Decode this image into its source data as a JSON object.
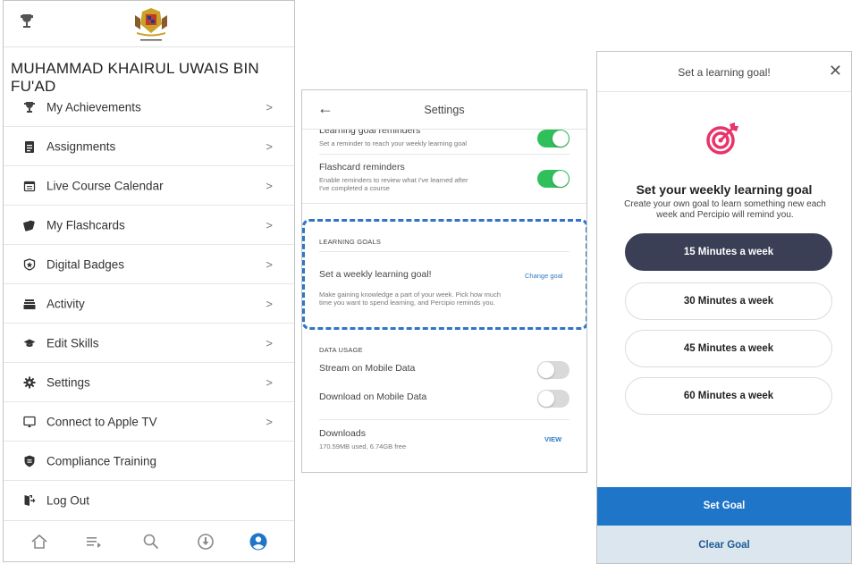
{
  "profile": {
    "user_name": "MUHAMMAD KHAIRUL UWAIS BIN FU'AD",
    "menu": [
      {
        "label": "My Achievements",
        "icon": "trophy-icon",
        "chevron": ">"
      },
      {
        "label": "Assignments",
        "icon": "clipboard-icon",
        "chevron": ">"
      },
      {
        "label": "Live Course Calendar",
        "icon": "calendar-icon",
        "chevron": ">"
      },
      {
        "label": "My Flashcards",
        "icon": "flashcards-icon",
        "chevron": ">"
      },
      {
        "label": "Digital Badges",
        "icon": "badge-icon",
        "chevron": ">"
      },
      {
        "label": "Activity",
        "icon": "activity-icon",
        "chevron": ">"
      },
      {
        "label": "Edit Skills",
        "icon": "graduation-cap-icon",
        "chevron": ">"
      },
      {
        "label": "Settings",
        "icon": "gear-icon",
        "chevron": ">"
      },
      {
        "label": "Connect to Apple TV",
        "icon": "cast-icon",
        "chevron": ">"
      },
      {
        "label": "Compliance Training",
        "icon": "shield-icon",
        "chevron": ""
      },
      {
        "label": "Log Out",
        "icon": "logout-icon",
        "chevron": ""
      }
    ],
    "bottom_nav": [
      "home-icon",
      "playlist-icon",
      "search-icon",
      "download-icon",
      "profile-icon"
    ],
    "active_nav_color": "#1f76c8"
  },
  "settings": {
    "title": "Settings",
    "back": "←",
    "learning_goal_reminders": {
      "title": "Learning goal reminders",
      "subtitle": "Set a reminder to reach your weekly learning goal",
      "enabled": true
    },
    "flashcard_reminders": {
      "title": "Flashcard reminders",
      "subtitle_line1": "Enable reminders to review what I've learned after",
      "subtitle_line2": "I've completed a course",
      "enabled": true
    },
    "learning_goals": {
      "header": "LEARNING GOALS",
      "title": "Set a weekly learning goal!",
      "link": "Change goal",
      "desc_line1": "Make gaining knowledge a part of your week. Pick how much",
      "desc_line2": "time you want to spend learning, and Percipio reminds you."
    },
    "data_usage": {
      "header": "DATA USAGE",
      "stream": {
        "label": "Stream on Mobile Data",
        "enabled": false
      },
      "download": {
        "label": "Download on Mobile Data",
        "enabled": false
      },
      "downloads": {
        "title": "Downloads",
        "usage": "170.59MB used, 6.74GB free",
        "link": "VIEW"
      }
    },
    "toggle_on_color": "#2fbf5b",
    "highlight_color": "#2f74c8"
  },
  "goal": {
    "header_title": "Set a learning goal!",
    "close": "✕",
    "heading": "Set your weekly learning goal",
    "desc_line1": "Create your own goal to learn something new each",
    "desc_line2": "week and Percipio will remind you.",
    "options": [
      {
        "label": "15 Minutes a week",
        "selected": true
      },
      {
        "label": "30 Minutes a week",
        "selected": false
      },
      {
        "label": "45 Minutes a week",
        "selected": false
      },
      {
        "label": "60 Minutes a week",
        "selected": false
      }
    ],
    "set_goal": "Set Goal",
    "clear_goal": "Clear Goal",
    "accent_color": "#e8336b",
    "primary_color": "#1f76c8"
  }
}
